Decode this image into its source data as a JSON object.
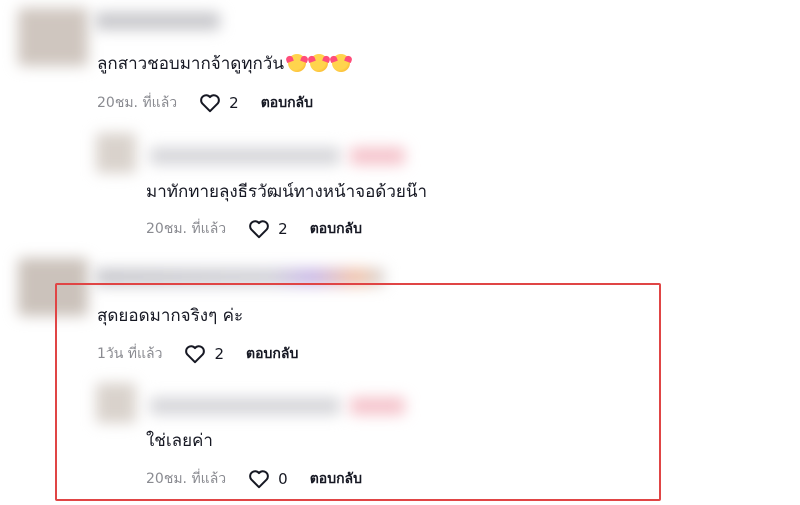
{
  "comments": [
    {
      "text": "ลูกสาวชอบมากจ้าดูทุกวัน",
      "emojis": [
        "smiling-face-with-hearts-icon",
        "smiling-face-with-hearts-icon",
        "smiling-face-with-hearts-icon"
      ],
      "time": "20ชม. ที่แล้ว",
      "likes": "2",
      "reply_label": "ตอบกลับ"
    },
    {
      "text": "มาทักทายลุงธีรวัฒน์ทางหน้าจอด้วยน๊า",
      "time": "20ชม. ที่แล้ว",
      "likes": "2",
      "reply_label": "ตอบกลับ"
    },
    {
      "text": "สุดยอดมากจริงๆ ค่ะ",
      "time": "1วัน ที่แล้ว",
      "likes": "2",
      "reply_label": "ตอบกลับ"
    },
    {
      "text": "ใช่เลยค่า",
      "time": "20ชม. ที่แล้ว",
      "likes": "0",
      "reply_label": "ตอบกลับ"
    }
  ],
  "colors": {
    "highlight_border": "#e04545",
    "meta_text": "#8a8b91",
    "body_text": "#161823"
  }
}
